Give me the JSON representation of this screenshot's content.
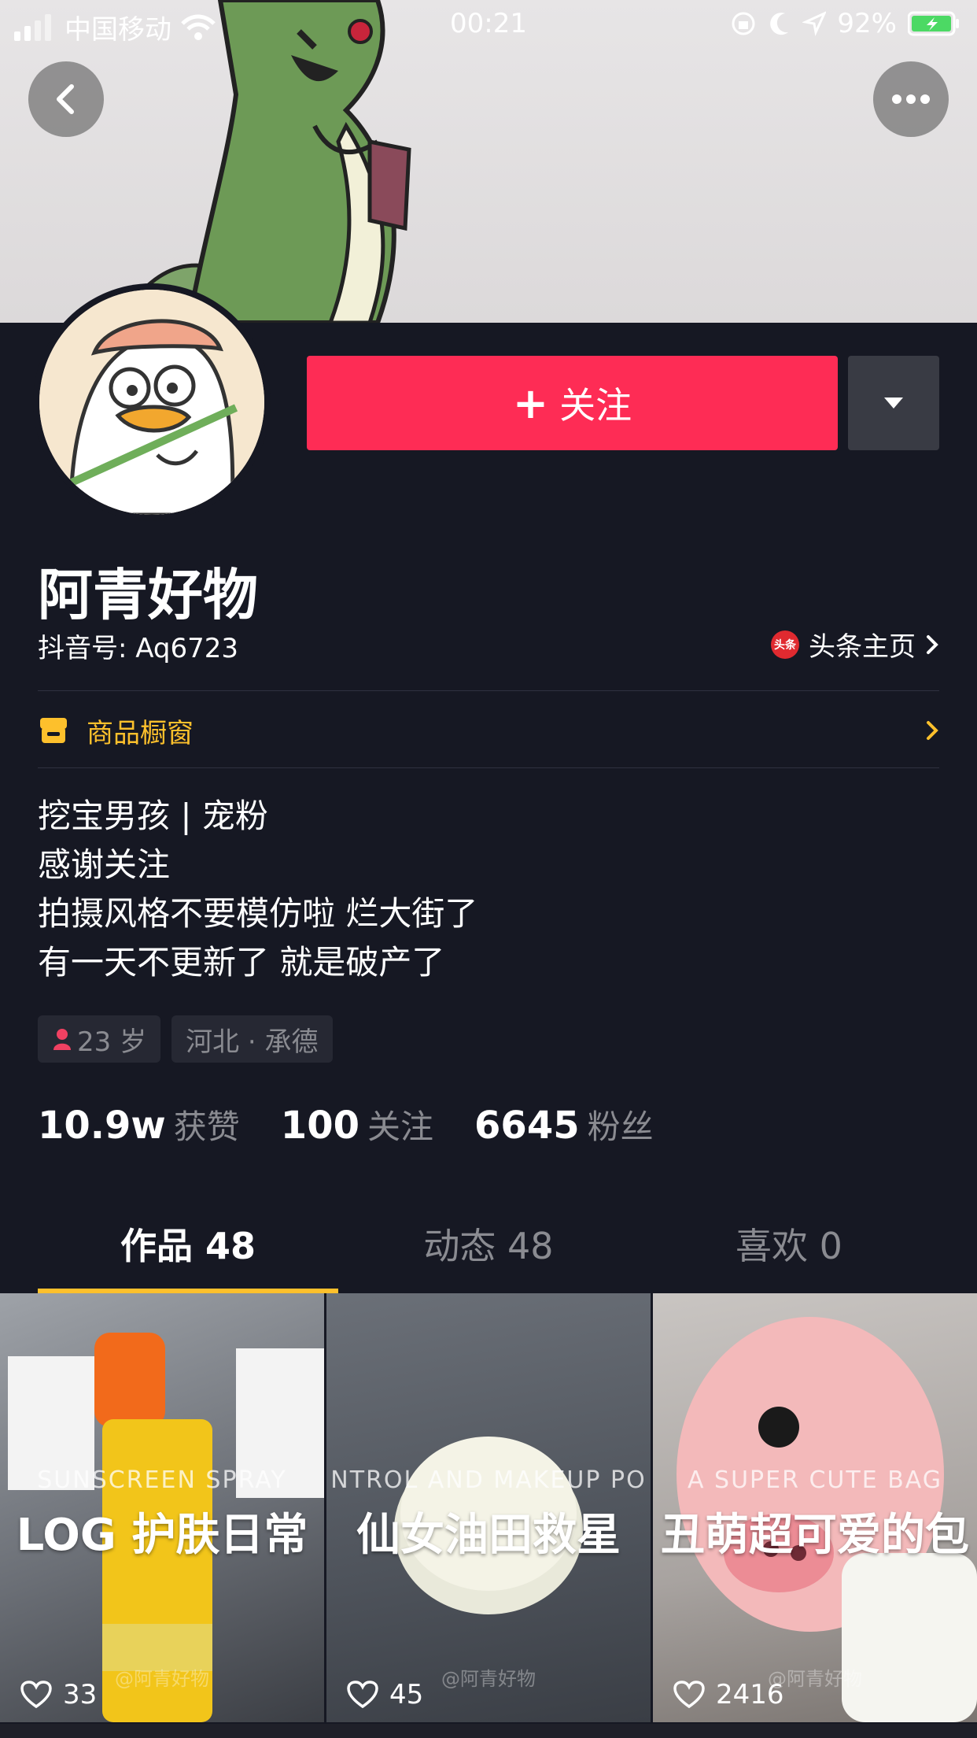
{
  "status_bar": {
    "carrier": "中国移动",
    "time": "00:21",
    "battery": "92%"
  },
  "profile": {
    "follow_label": "关注",
    "name": "阿青好物",
    "douyin_id": "抖音号: Aq6723",
    "toutiao_badge": "头条",
    "toutiao_link": "头条主页",
    "shop_window": "商品橱窗",
    "bio": [
      "挖宝男孩 | 宠粉",
      "感谢关注",
      "拍摄风格不要模仿啦 烂大街了",
      "有一天不更新了 就是破产了"
    ],
    "tags": {
      "age": "23 岁",
      "location": "河北 · 承德"
    },
    "stats": [
      {
        "num": "10.9w",
        "label": "获赞"
      },
      {
        "num": "100",
        "label": "关注"
      },
      {
        "num": "6645",
        "label": "粉丝"
      }
    ]
  },
  "tabs": [
    {
      "label": "作品 48"
    },
    {
      "label": "动态 48"
    },
    {
      "label": "喜欢 0"
    }
  ],
  "videos": [
    {
      "en": "SUNSCREEN SPRAY",
      "cn": "LOG 护肤日常",
      "watermark": "@阿青好物",
      "likes": "33"
    },
    {
      "en": "NTROL AND MAKEUP PO",
      "cn": "仙女油田救星",
      "watermark": "@阿青好物",
      "likes": "45"
    },
    {
      "en": "A SUPER CUTE BAG",
      "cn": "丑萌超可爱的包",
      "watermark": "@阿青好物",
      "likes": "2416"
    }
  ],
  "colors": {
    "background": "#161823",
    "follow_button": "#fe2c55",
    "accent_yellow": "#fdc02c",
    "muted_text": "#8a8b91"
  }
}
